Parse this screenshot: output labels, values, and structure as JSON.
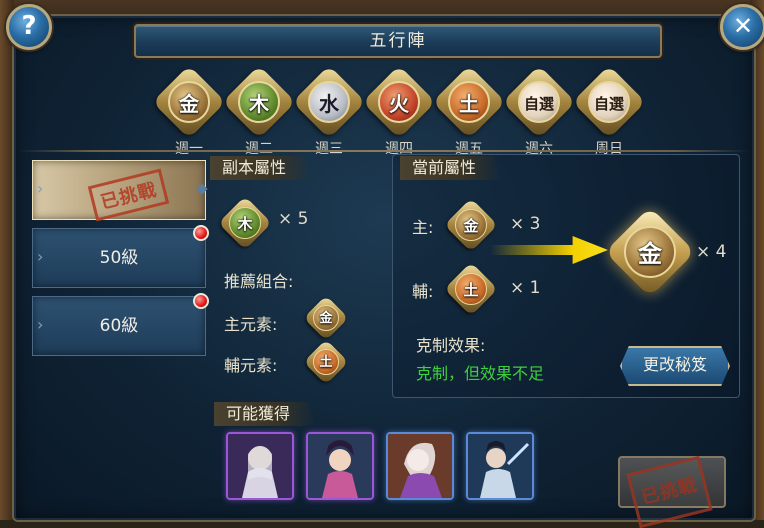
{
  "window": {
    "title": "五行陣",
    "help_label": "?",
    "close_label": "✕"
  },
  "days": [
    {
      "element": "金",
      "label": "週一",
      "type": "gold"
    },
    {
      "element": "木",
      "label": "週二",
      "type": "wood"
    },
    {
      "element": "水",
      "label": "週三",
      "type": "water"
    },
    {
      "element": "火",
      "label": "週四",
      "type": "fire"
    },
    {
      "element": "土",
      "label": "週五",
      "type": "earth"
    },
    {
      "element": "自選",
      "label": "週六",
      "type": "custom"
    },
    {
      "element": "自選",
      "label": "周日",
      "type": "custom"
    }
  ],
  "tabs": [
    {
      "label": "",
      "stamp": "已挑戰",
      "selected": true,
      "has_dot": false
    },
    {
      "label": "50級",
      "stamp": "",
      "selected": false,
      "has_dot": true
    },
    {
      "label": "60級",
      "stamp": "",
      "selected": false,
      "has_dot": true
    }
  ],
  "instance": {
    "header": "副本屬性",
    "element": "木",
    "multiplier": "× 5",
    "recommend_label": "推薦組合:",
    "main_label": "主元素:",
    "main_element": "金",
    "aux_label": "輔元素:",
    "aux_element": "土"
  },
  "current": {
    "header": "當前屬性",
    "main_label": "主:",
    "main_element": "金",
    "main_mult": "× 3",
    "aux_label": "輔:",
    "aux_element": "土",
    "aux_mult": "× 1",
    "result_element": "金",
    "result_mult": "× 4",
    "effect_label": "克制效果:",
    "effect_text": "克制，但效果不足",
    "change_button": "更改秘笈"
  },
  "rewards": {
    "header": "可能獲得",
    "items": [
      {
        "name": "reward-1",
        "rarity": "purple"
      },
      {
        "name": "reward-2",
        "rarity": "purple"
      },
      {
        "name": "reward-3",
        "rarity": "blue"
      },
      {
        "name": "reward-4",
        "rarity": "blue"
      }
    ]
  },
  "challenge": {
    "stamp": "已挑戰"
  },
  "colors": {
    "accent_gold": "#c4a050",
    "effect_green": "#3ed13e",
    "dot_red": "#e01818"
  }
}
